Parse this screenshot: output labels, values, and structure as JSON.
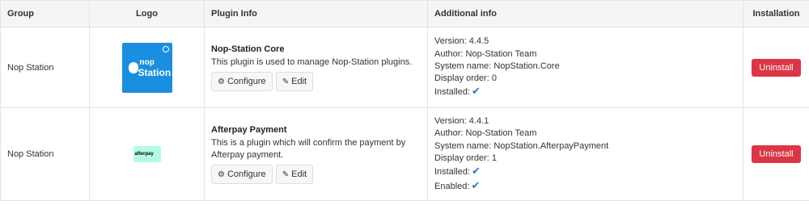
{
  "table": {
    "headers": {
      "group": "Group",
      "logo": "Logo",
      "plugin_info": "Plugin Info",
      "additional_info": "Additional info",
      "installation": "Installation"
    },
    "rows": [
      {
        "group": "Nop Station",
        "logo": {
          "icon": "nop-station-logo",
          "line1": "nop",
          "line2": "Station",
          "color": "#1a8fe0"
        },
        "plugin_name": "Nop-Station Core",
        "description": "This plugin is used to manage Nop-Station plugins.",
        "configure_label": "Configure",
        "edit_label": "Edit",
        "version": "Version: 4.4.5",
        "author": "Author: Nop-Station Team",
        "system_name": "System name: NopStation.Core",
        "display_order": "Display order: 0",
        "installed": "Installed:",
        "uninstall_label": "Uninstall"
      },
      {
        "group": "Nop Station",
        "logo": {
          "icon": "afterpay-logo",
          "text": "afterpay",
          "color": "#b2fce4"
        },
        "plugin_name": "Afterpay Payment",
        "description": "This is a plugin which will confirm the payment by Afterpay payment.",
        "configure_label": "Configure",
        "edit_label": "Edit",
        "version": "Version: 4.4.1",
        "author": "Author: Nop-Station Team",
        "system_name": "System name: NopStation.AfterpayPayment",
        "display_order": "Display order: 1",
        "installed": "Installed:",
        "enabled": "Enabled:",
        "uninstall_label": "Uninstall"
      }
    ]
  },
  "colors": {
    "uninstall": "#dc3545",
    "check": "#1f7fd1",
    "header_bg": "#f5f5f5"
  }
}
